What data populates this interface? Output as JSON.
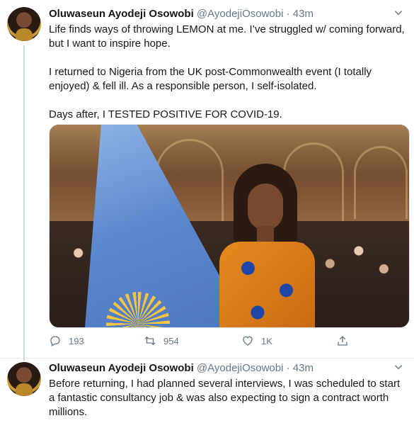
{
  "tweets": [
    {
      "name": "Oluwaseun Ayodeji Osowobi",
      "handle": "@AyodejiOsowobi",
      "separator": "·",
      "time": "43m",
      "paragraphs": [
        "Life finds ways of throwing LEMON at me. I’ve struggled w/ coming forward, but I want to inspire hope.",
        "I returned to Nigeria from the UK post-Commonwealth event (I totally enjoyed) & fell ill. As a responsible person, I self-isolated.",
        "Days after, I TESTED POSITIVE FOR COVID-19."
      ],
      "actions": {
        "reply_count": "193",
        "retweet_count": "954",
        "like_count": "1K"
      }
    },
    {
      "name": "Oluwaseun Ayodeji Osowobi",
      "handle": "@AyodejiOsowobi",
      "separator": "·",
      "time": "43m",
      "paragraphs": [
        "Before returning, I had planned several interviews, I was scheduled to start a fantastic consultancy job & was also expecting to sign a contract worth millions."
      ]
    }
  ],
  "icons": {
    "reply": "reply-icon",
    "retweet": "retweet-icon",
    "like": "heart-icon",
    "share": "share-icon",
    "more": "chevron-down-icon"
  },
  "colors": {
    "secondary_text": "#657786",
    "thread_line": "#ccd6dd",
    "divider": "#e6ecf0"
  }
}
